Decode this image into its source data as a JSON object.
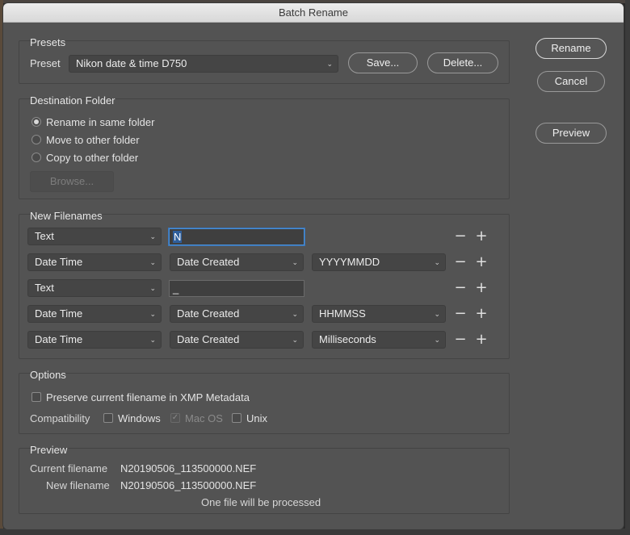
{
  "window": {
    "title": "Batch Rename"
  },
  "presets": {
    "title": "Presets",
    "label": "Preset",
    "selected": "Nikon date & time D750",
    "save_label": "Save...",
    "delete_label": "Delete..."
  },
  "actions": {
    "rename": "Rename",
    "cancel": "Cancel",
    "preview": "Preview"
  },
  "destination": {
    "title": "Destination Folder",
    "options": [
      "Rename in same folder",
      "Move to other folder",
      "Copy to other folder"
    ],
    "selected_index": 0,
    "browse_label": "Browse..."
  },
  "filenames": {
    "title": "New Filenames",
    "rows": [
      {
        "type": "Text",
        "value": "N"
      },
      {
        "type": "Date Time",
        "field": "Date Created",
        "format": "YYYYMMDD"
      },
      {
        "type": "Text",
        "value": "_"
      },
      {
        "type": "Date Time",
        "field": "Date Created",
        "format": "HHMMSS"
      },
      {
        "type": "Date Time",
        "field": "Date Created",
        "format": "Milliseconds"
      }
    ],
    "minus": "−",
    "plus": "+"
  },
  "options": {
    "title": "Options",
    "preserve_label": "Preserve current filename in XMP Metadata",
    "compat_label": "Compatibility",
    "windows": "Windows",
    "macos": "Mac OS",
    "unix": "Unix"
  },
  "preview": {
    "title": "Preview",
    "current_label": "Current filename",
    "current_value": "N20190506_113500000.NEF",
    "new_label": "New filename",
    "new_value": "N20190506_113500000.NEF",
    "summary": "One file will be processed"
  }
}
